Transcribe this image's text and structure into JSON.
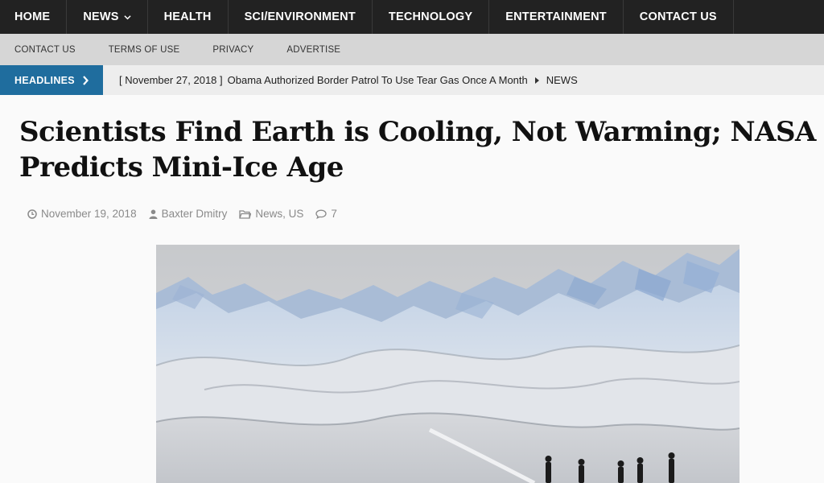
{
  "topnav": {
    "items": [
      "HOME",
      "NEWS",
      "HEALTH",
      "SCI/ENVIRONMENT",
      "TECHNOLOGY",
      "ENTERTAINMENT",
      "CONTACT US"
    ]
  },
  "subnav": {
    "items": [
      "CONTACT US",
      "TERMS OF USE",
      "PRIVACY",
      "ADVERTISE"
    ]
  },
  "ticker": {
    "label": "HEADLINES",
    "date": "[ November 27, 2018 ]",
    "headline": "Obama Authorized Border Patrol To Use Tear Gas Once A Month",
    "category": "NEWS"
  },
  "article": {
    "title": "Scientists Find Earth is Cooling, Not Warming; NASA Predicts Mini-Ice Age",
    "date": "November 19, 2018",
    "author": "Baxter Dmitry",
    "category_1": "News",
    "category_2": "US",
    "comments": "7"
  },
  "icons": {
    "date": "clock-icon",
    "author": "user-icon",
    "category": "folder-icon",
    "comments": "comment-icon"
  },
  "colors": {
    "topnav_bg": "#222222",
    "subnav_bg": "#d6d6d6",
    "headlines_label_bg": "#1f6d9e"
  }
}
